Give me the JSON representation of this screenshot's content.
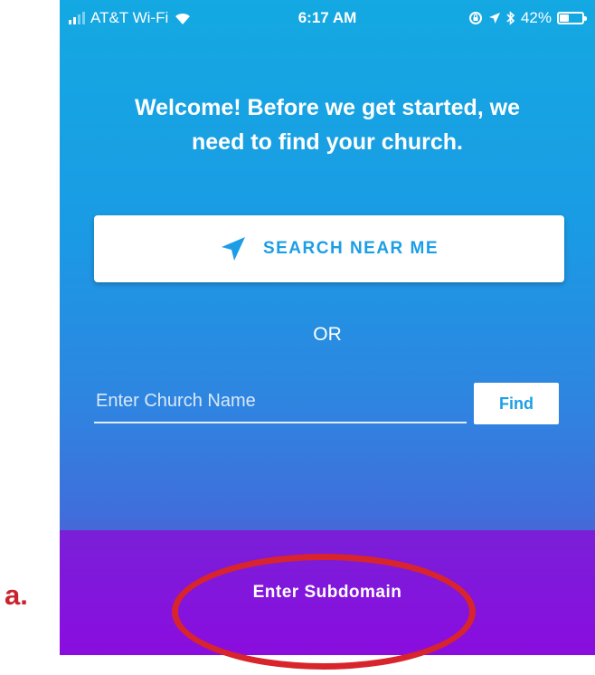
{
  "status_bar": {
    "carrier": "AT&T Wi-Fi",
    "time": "6:17 AM",
    "battery": "42%",
    "battery_level": 0.42,
    "icons": [
      "signal-icon",
      "wifi-icon",
      "orientation-lock-icon",
      "location-icon",
      "bluetooth-icon",
      "battery-icon"
    ]
  },
  "welcome": {
    "line1": "Welcome! Before we get started, we",
    "line2": "need to find your church."
  },
  "search_near": {
    "label": "SEARCH NEAR ME",
    "icon": "location-arrow-icon"
  },
  "or_label": "OR",
  "church_search": {
    "value": "",
    "placeholder": "Enter Church Name",
    "find_label": "Find"
  },
  "subdomain": {
    "label": "Enter Subdomain"
  },
  "annotation": {
    "label": "a."
  },
  "colors": {
    "accent": "#1c9ee6",
    "top_gradient": "#14a9e2",
    "bottom_bar": "#8a0ddf",
    "annotation": "#d8242c"
  }
}
